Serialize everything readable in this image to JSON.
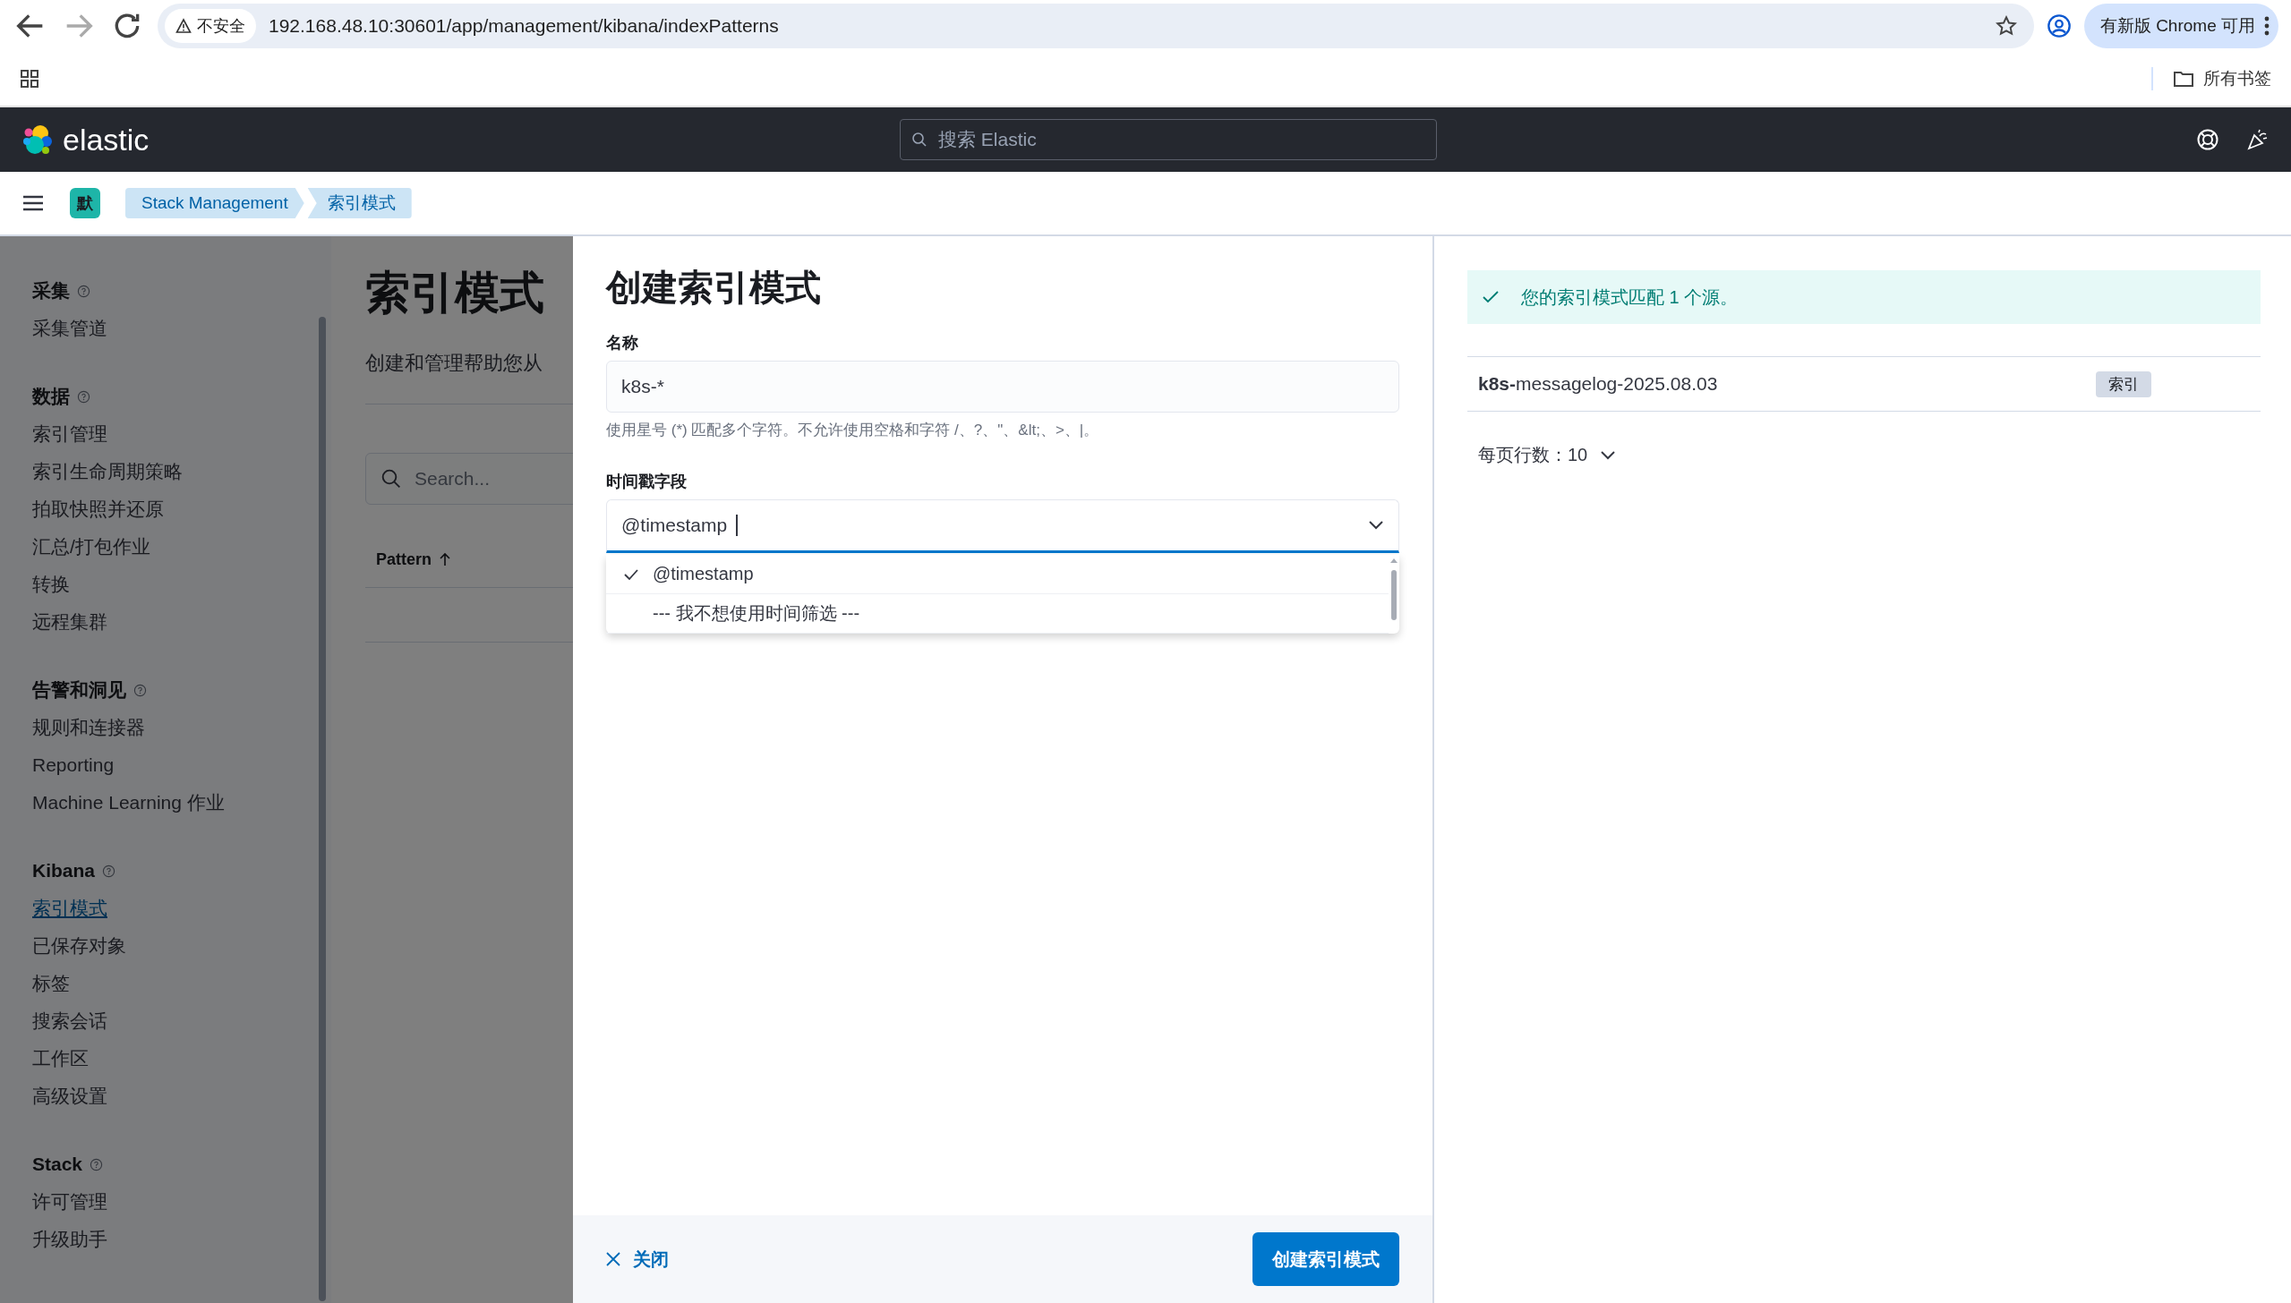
{
  "browser": {
    "security": "不安全",
    "url": "192.168.48.10:30601/app/management/kibana/indexPatterns",
    "update_button": "有新版 Chrome 可用",
    "bookmarks_folder": "所有书签"
  },
  "header": {
    "logo": "elastic",
    "search_placeholder": "搜索 Elastic"
  },
  "space_badge": "默",
  "breadcrumbs": [
    {
      "label": "Stack Management"
    },
    {
      "label": "索引模式"
    }
  ],
  "sidebar": {
    "sections": [
      {
        "title": "采集",
        "items": [
          {
            "label": "采集管道",
            "selected": false
          }
        ]
      },
      {
        "title": "数据",
        "items": [
          {
            "label": "索引管理",
            "selected": false
          },
          {
            "label": "索引生命周期策略",
            "selected": false
          },
          {
            "label": "拍取快照并还原",
            "selected": false
          },
          {
            "label": "汇总/打包作业",
            "selected": false
          },
          {
            "label": "转换",
            "selected": false
          },
          {
            "label": "远程集群",
            "selected": false
          }
        ]
      },
      {
        "title": "告警和洞见",
        "items": [
          {
            "label": "规则和连接器",
            "selected": false
          },
          {
            "label": "Reporting",
            "selected": false
          },
          {
            "label": "Machine Learning 作业",
            "selected": false
          }
        ]
      },
      {
        "title": "Kibana",
        "items": [
          {
            "label": "索引模式",
            "selected": true
          },
          {
            "label": "已保存对象",
            "selected": false
          },
          {
            "label": "标签",
            "selected": false
          },
          {
            "label": "搜索会话",
            "selected": false
          },
          {
            "label": "工作区",
            "selected": false
          },
          {
            "label": "高级设置",
            "selected": false
          }
        ]
      },
      {
        "title": "Stack",
        "items": [
          {
            "label": "许可管理",
            "selected": false
          },
          {
            "label": "升级助手",
            "selected": false
          }
        ]
      }
    ]
  },
  "page": {
    "title": "索引模式",
    "description": "创建和管理帮助您从",
    "search_placeholder": "Search...",
    "column": "Pattern"
  },
  "flyout": {
    "title": "创建索引模式",
    "name_label": "名称",
    "name_value": "k8s-*",
    "name_help": "使用星号 (*) 匹配多个字符。不允许使用空格和字符 /、?、\"、&lt;、>、|。",
    "timestamp_label": "时间戳字段",
    "timestamp_value": "@timestamp",
    "options": [
      {
        "label": "@timestamp",
        "selected": true
      },
      {
        "label": "--- 我不想使用时间筛选 ---",
        "selected": false
      }
    ],
    "close_button": "关闭",
    "create_button": "创建索引模式"
  },
  "preview": {
    "callout": "您的索引模式匹配 1 个源。",
    "rows": [
      {
        "name": "**k8s-**messagelog-2025.08.03",
        "tag": "索引"
      }
    ],
    "per_page": "每页行数：10"
  }
}
